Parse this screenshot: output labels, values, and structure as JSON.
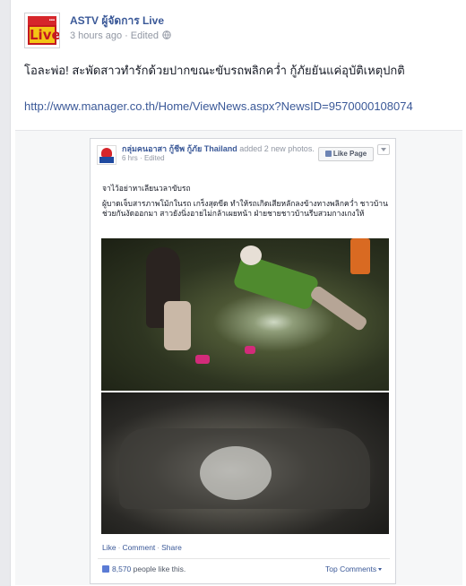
{
  "post": {
    "page_name": "ASTV ผู้จัดการ Live",
    "timestamp": "3 hours ago",
    "separator": "·",
    "edited_label": "Edited",
    "privacy_icon": "globe-icon",
    "avatar_logo_text": "Live",
    "text": "โอละพ่อ! สะพัดสาวทำรักด้วยปากขณะขับรถพลิกคว่ำ กู้ภัยยันแค่อุบัติเหตุปกติ",
    "link": "http://www.manager.co.th/Home/ViewNews.aspx?NewsID=9570000108074"
  },
  "shared": {
    "page_name": "กลุ่มคนอาสา กู้ชีพ กู้ภัย Thailand",
    "added_text": "added 2 new photos.",
    "time": "6 hrs",
    "separator": "·",
    "edited_label": "Edited",
    "like_page_label": "Like Page",
    "body_line1": "จาไว้อย่าหาเลียนวลาขับรถ",
    "body_line2": "ผู้บาดเจ็บสารภาพโม้กในรถ เกร็งสุดขีด ทำให้รถเกิดเสียหลักลงข้างทางพลิกคว่ำ ชาวบ้านช่วยกันงัดออกมา สาวยังนิ่งอายไม่กล้าเผยหน้า ฝ่ายชายชาวบ้านรีบสวมกางเกงให้",
    "actions": {
      "like": "Like",
      "comment": "Comment",
      "share": "Share",
      "separator": "·"
    },
    "likes_count": "8,570",
    "likes_suffix": "people like this.",
    "top_comments_label": "Top Comments"
  },
  "colors": {
    "link": "#3b5998",
    "muted": "#9197a3",
    "text": "#141823",
    "background": "#e9eaed"
  }
}
